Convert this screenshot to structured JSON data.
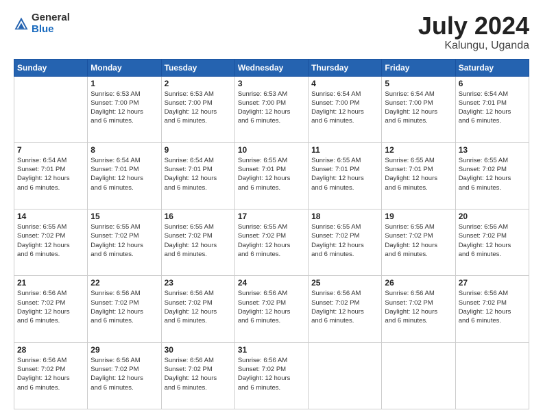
{
  "header": {
    "logo_general": "General",
    "logo_blue": "Blue",
    "title": "July 2024",
    "subtitle": "Kalungu, Uganda"
  },
  "days_of_week": [
    "Sunday",
    "Monday",
    "Tuesday",
    "Wednesday",
    "Thursday",
    "Friday",
    "Saturday"
  ],
  "weeks": [
    [
      {
        "num": "",
        "info": ""
      },
      {
        "num": "1",
        "info": "Sunrise: 6:53 AM\nSunset: 7:00 PM\nDaylight: 12 hours\nand 6 minutes."
      },
      {
        "num": "2",
        "info": "Sunrise: 6:53 AM\nSunset: 7:00 PM\nDaylight: 12 hours\nand 6 minutes."
      },
      {
        "num": "3",
        "info": "Sunrise: 6:53 AM\nSunset: 7:00 PM\nDaylight: 12 hours\nand 6 minutes."
      },
      {
        "num": "4",
        "info": "Sunrise: 6:54 AM\nSunset: 7:00 PM\nDaylight: 12 hours\nand 6 minutes."
      },
      {
        "num": "5",
        "info": "Sunrise: 6:54 AM\nSunset: 7:00 PM\nDaylight: 12 hours\nand 6 minutes."
      },
      {
        "num": "6",
        "info": "Sunrise: 6:54 AM\nSunset: 7:01 PM\nDaylight: 12 hours\nand 6 minutes."
      }
    ],
    [
      {
        "num": "7",
        "info": "Sunrise: 6:54 AM\nSunset: 7:01 PM\nDaylight: 12 hours\nand 6 minutes."
      },
      {
        "num": "8",
        "info": "Sunrise: 6:54 AM\nSunset: 7:01 PM\nDaylight: 12 hours\nand 6 minutes."
      },
      {
        "num": "9",
        "info": "Sunrise: 6:54 AM\nSunset: 7:01 PM\nDaylight: 12 hours\nand 6 minutes."
      },
      {
        "num": "10",
        "info": "Sunrise: 6:55 AM\nSunset: 7:01 PM\nDaylight: 12 hours\nand 6 minutes."
      },
      {
        "num": "11",
        "info": "Sunrise: 6:55 AM\nSunset: 7:01 PM\nDaylight: 12 hours\nand 6 minutes."
      },
      {
        "num": "12",
        "info": "Sunrise: 6:55 AM\nSunset: 7:01 PM\nDaylight: 12 hours\nand 6 minutes."
      },
      {
        "num": "13",
        "info": "Sunrise: 6:55 AM\nSunset: 7:02 PM\nDaylight: 12 hours\nand 6 minutes."
      }
    ],
    [
      {
        "num": "14",
        "info": "Sunrise: 6:55 AM\nSunset: 7:02 PM\nDaylight: 12 hours\nand 6 minutes."
      },
      {
        "num": "15",
        "info": "Sunrise: 6:55 AM\nSunset: 7:02 PM\nDaylight: 12 hours\nand 6 minutes."
      },
      {
        "num": "16",
        "info": "Sunrise: 6:55 AM\nSunset: 7:02 PM\nDaylight: 12 hours\nand 6 minutes."
      },
      {
        "num": "17",
        "info": "Sunrise: 6:55 AM\nSunset: 7:02 PM\nDaylight: 12 hours\nand 6 minutes."
      },
      {
        "num": "18",
        "info": "Sunrise: 6:55 AM\nSunset: 7:02 PM\nDaylight: 12 hours\nand 6 minutes."
      },
      {
        "num": "19",
        "info": "Sunrise: 6:55 AM\nSunset: 7:02 PM\nDaylight: 12 hours\nand 6 minutes."
      },
      {
        "num": "20",
        "info": "Sunrise: 6:56 AM\nSunset: 7:02 PM\nDaylight: 12 hours\nand 6 minutes."
      }
    ],
    [
      {
        "num": "21",
        "info": "Sunrise: 6:56 AM\nSunset: 7:02 PM\nDaylight: 12 hours\nand 6 minutes."
      },
      {
        "num": "22",
        "info": "Sunrise: 6:56 AM\nSunset: 7:02 PM\nDaylight: 12 hours\nand 6 minutes."
      },
      {
        "num": "23",
        "info": "Sunrise: 6:56 AM\nSunset: 7:02 PM\nDaylight: 12 hours\nand 6 minutes."
      },
      {
        "num": "24",
        "info": "Sunrise: 6:56 AM\nSunset: 7:02 PM\nDaylight: 12 hours\nand 6 minutes."
      },
      {
        "num": "25",
        "info": "Sunrise: 6:56 AM\nSunset: 7:02 PM\nDaylight: 12 hours\nand 6 minutes."
      },
      {
        "num": "26",
        "info": "Sunrise: 6:56 AM\nSunset: 7:02 PM\nDaylight: 12 hours\nand 6 minutes."
      },
      {
        "num": "27",
        "info": "Sunrise: 6:56 AM\nSunset: 7:02 PM\nDaylight: 12 hours\nand 6 minutes."
      }
    ],
    [
      {
        "num": "28",
        "info": "Sunrise: 6:56 AM\nSunset: 7:02 PM\nDaylight: 12 hours\nand 6 minutes."
      },
      {
        "num": "29",
        "info": "Sunrise: 6:56 AM\nSunset: 7:02 PM\nDaylight: 12 hours\nand 6 minutes."
      },
      {
        "num": "30",
        "info": "Sunrise: 6:56 AM\nSunset: 7:02 PM\nDaylight: 12 hours\nand 6 minutes."
      },
      {
        "num": "31",
        "info": "Sunrise: 6:56 AM\nSunset: 7:02 PM\nDaylight: 12 hours\nand 6 minutes."
      },
      {
        "num": "",
        "info": ""
      },
      {
        "num": "",
        "info": ""
      },
      {
        "num": "",
        "info": ""
      }
    ]
  ]
}
